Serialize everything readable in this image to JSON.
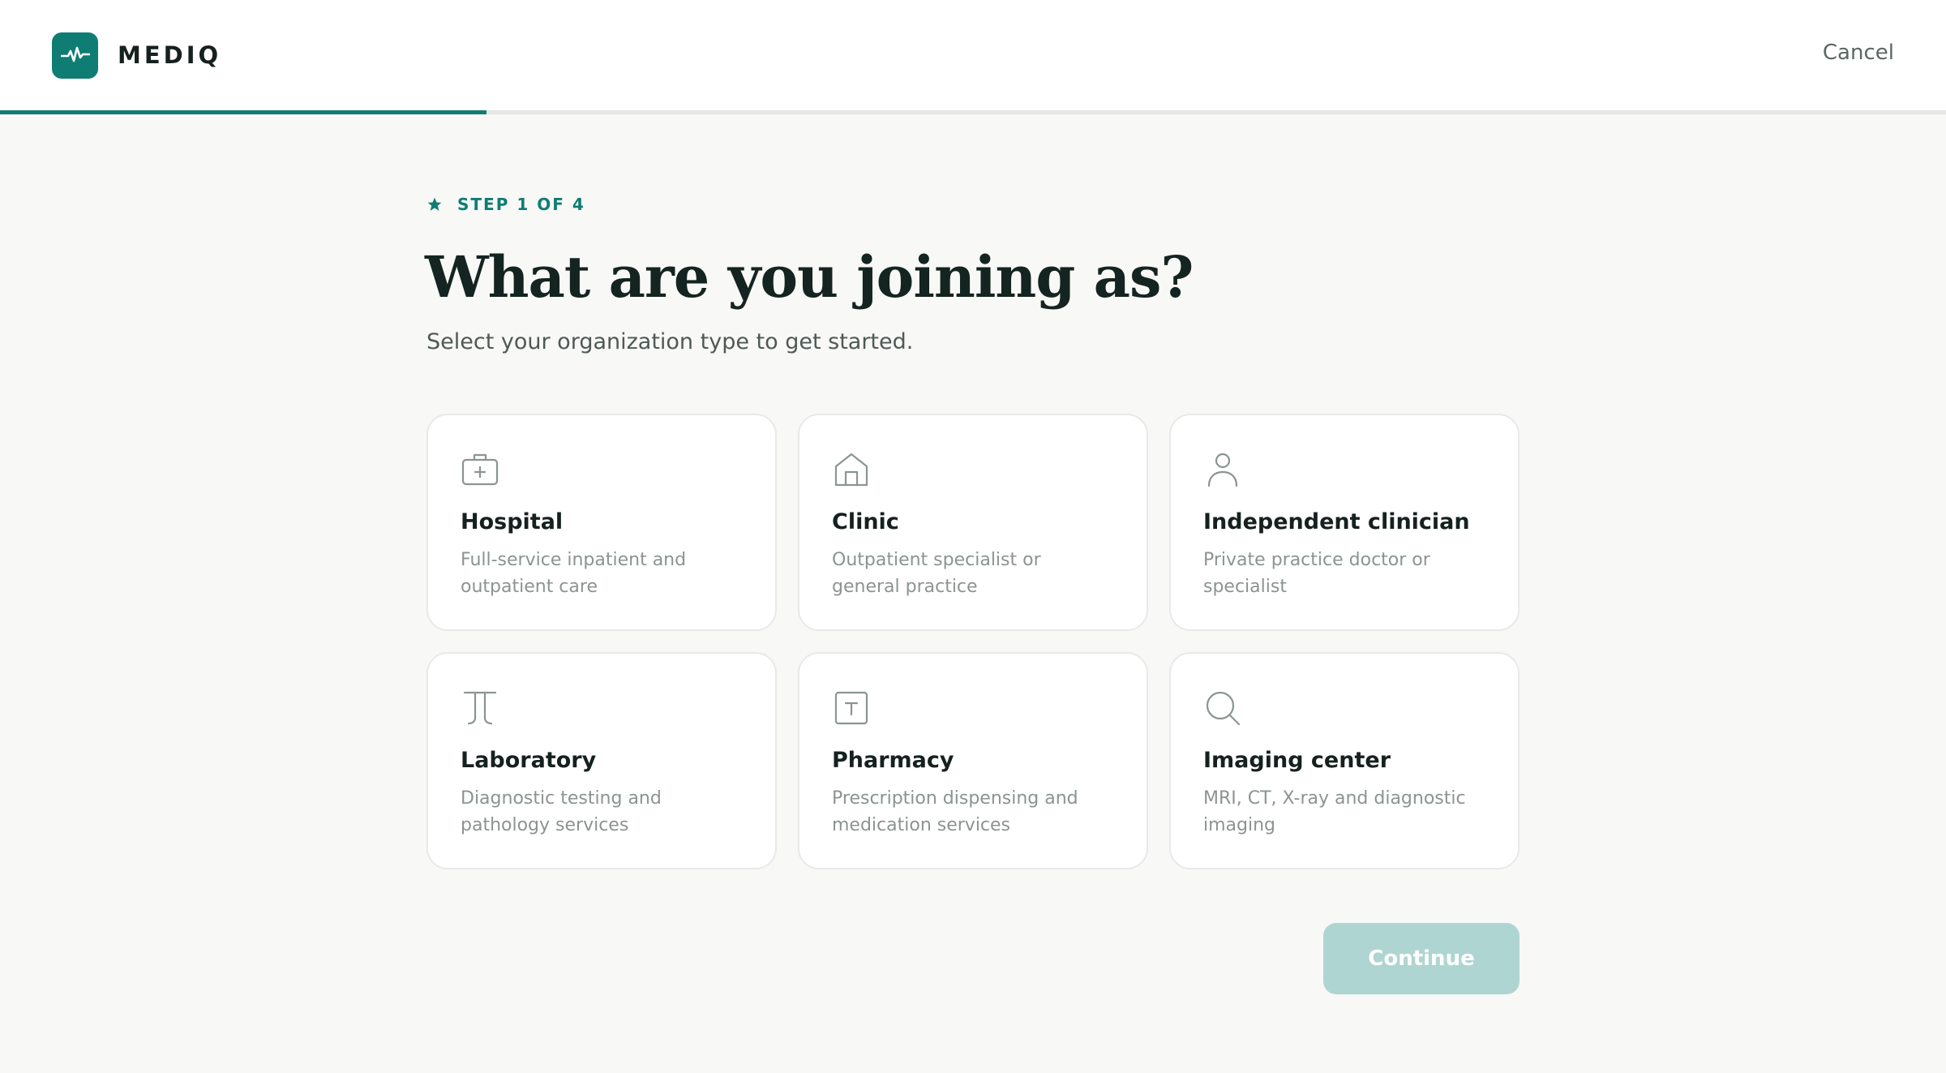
{
  "header": {
    "brand_name": "MEDIQ",
    "cancel_label": "Cancel",
    "progress_fraction": 0.25,
    "accent_color": "#0f7d73"
  },
  "intro": {
    "step_label": "STEP 1 OF 4",
    "title": "What are you joining as?",
    "subtitle": "Select your organization type to get started."
  },
  "options": [
    {
      "icon": "medical-bag-icon",
      "title": "Hospital",
      "description": "Full-service inpatient and outpatient care"
    },
    {
      "icon": "building-icon",
      "title": "Clinic",
      "description": "Outpatient specialist or general practice"
    },
    {
      "icon": "person-icon",
      "title": "Independent clinician",
      "description": "Private practice doctor or specialist"
    },
    {
      "icon": "test-tube-icon",
      "title": "Laboratory",
      "description": "Diagnostic testing and pathology services"
    },
    {
      "icon": "pharmacy-icon",
      "title": "Pharmacy",
      "description": "Prescription dispensing and medication services"
    },
    {
      "icon": "search-icon",
      "title": "Imaging center",
      "description": "MRI, CT, X-ray and diagnostic imaging"
    }
  ],
  "footer": {
    "continue_label": "Continue",
    "continue_state": "disabled"
  }
}
